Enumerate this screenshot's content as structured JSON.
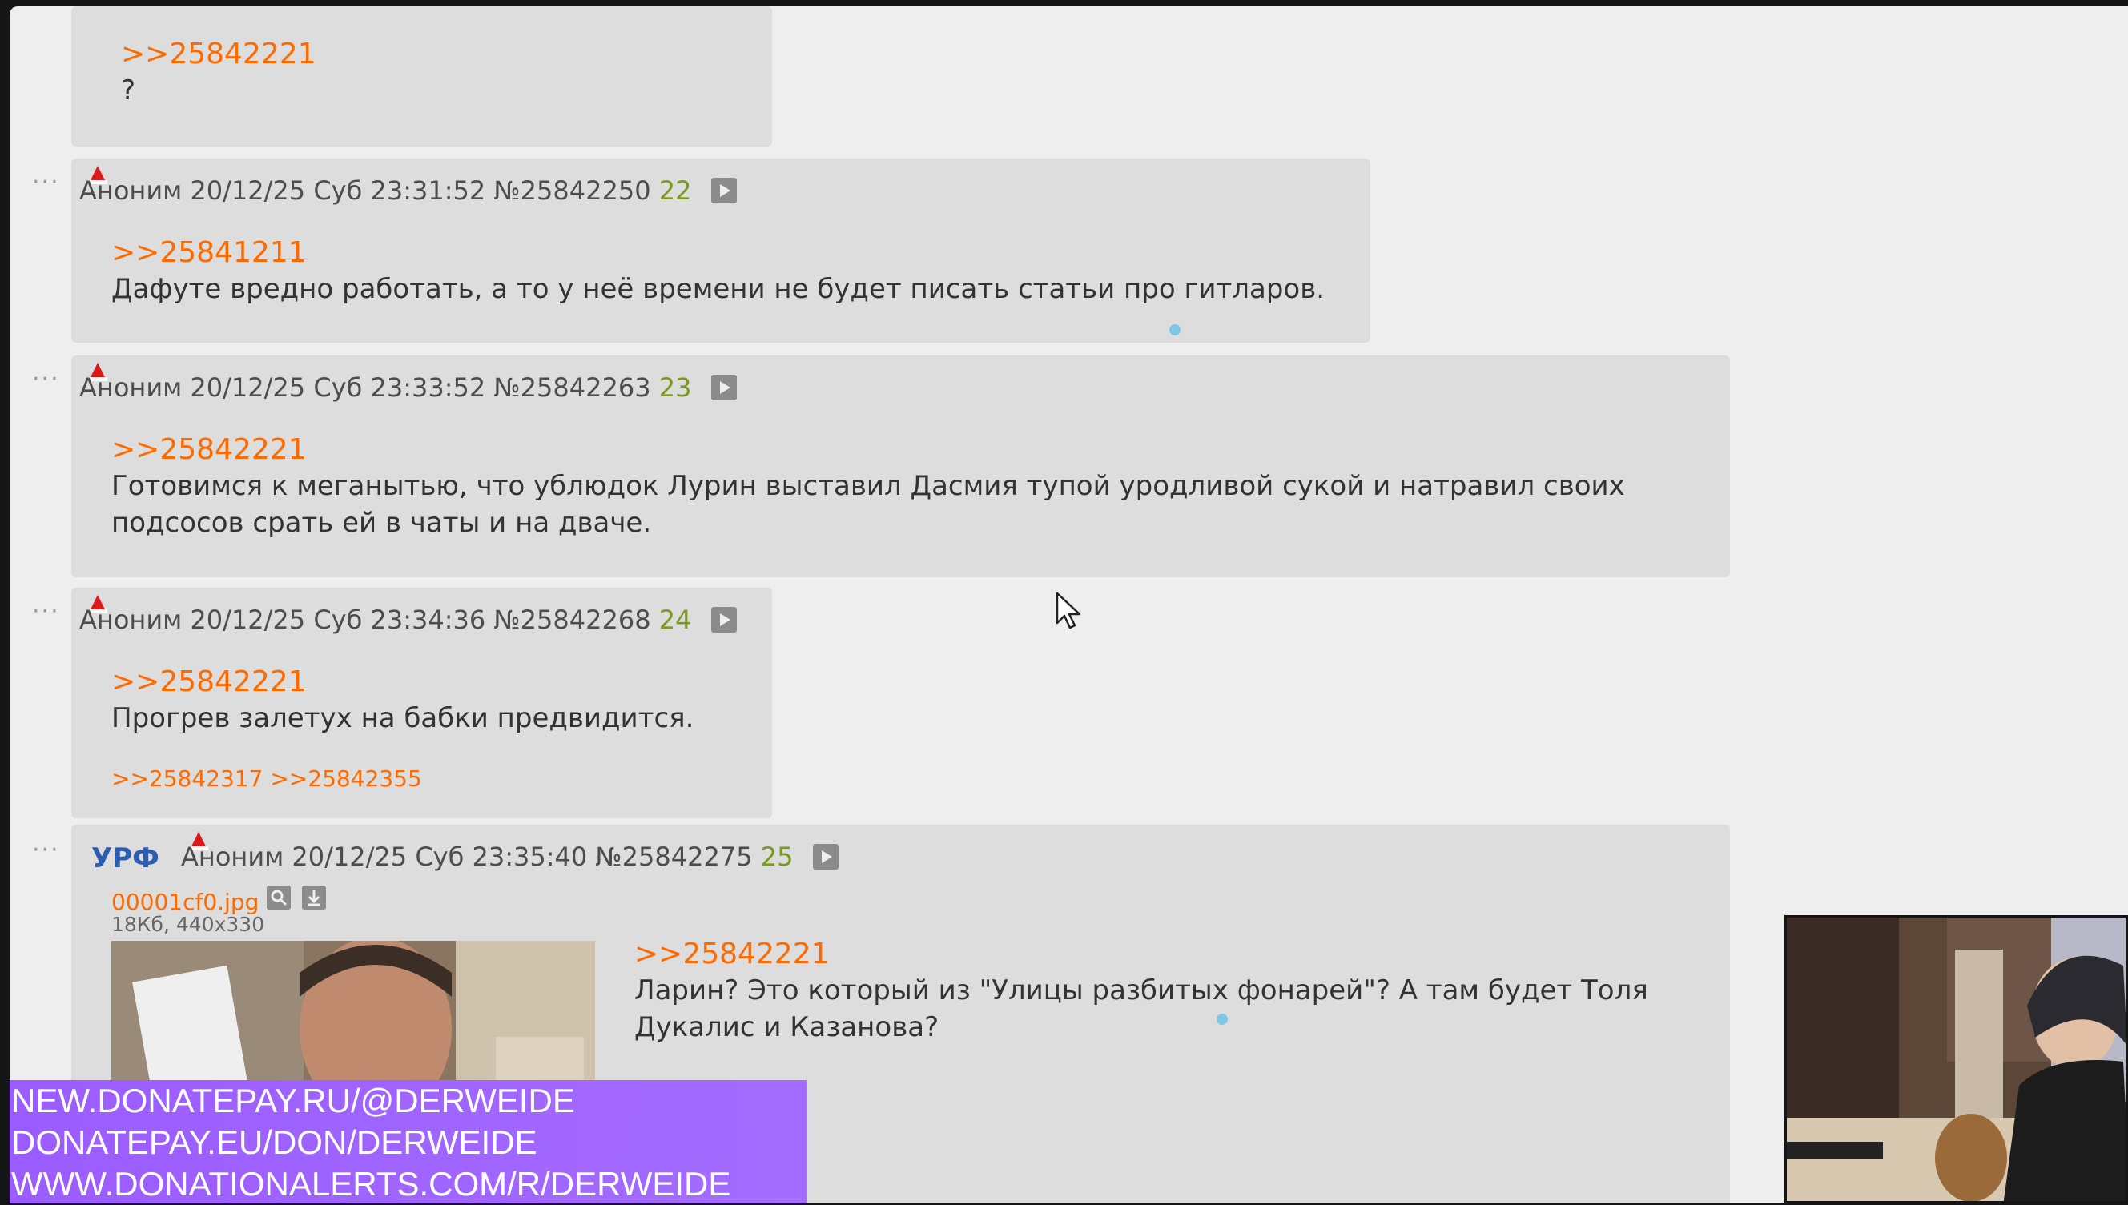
{
  "posts": [
    {
      "reply": ">>25842221",
      "text": "?"
    },
    {
      "author": "Аноним",
      "datetime": "20/12/25 Суб 23:31:52",
      "postnum": "№25842250",
      "index": "22",
      "reply": ">>25841211",
      "text": "Дафуте вредно работать, а то у неё времени не будет писать статьи про гитларов."
    },
    {
      "author": "Аноним",
      "datetime": "20/12/25 Суб 23:33:52",
      "postnum": "№25842263",
      "index": "23",
      "reply": ">>25842221",
      "text": "Готовимся к меганытью, что ублюдок Лурин выставил Дасмия тупой уродливой сукой и натравил своих подсосов срать ей в чаты и на дваче."
    },
    {
      "author": "Аноним",
      "datetime": "20/12/25 Суб 23:34:36",
      "postnum": "№25842268",
      "index": "24",
      "reply": ">>25842221",
      "text": "Прогрев залетух на бабки предвидится.",
      "backlinks": ">>25842317 >>25842355"
    },
    {
      "flag": "УРФ",
      "author": "Аноним",
      "datetime": "20/12/25 Суб 23:35:40",
      "postnum": "№25842275",
      "index": "25",
      "file_name": "00001cf0.jpg",
      "file_meta": "18Кб, 440x330",
      "reply": ">>25842221",
      "text": "Ларин? Это который из \"Улицы разбитых фонарей\"? А там будет Толя Дукалис и Казанова?"
    }
  ],
  "overlay": {
    "donate_lines": [
      "NEW.DONATEPAY.RU/@DERWEIDE",
      "DONATEPAY.EU/DON/DERWEIDE",
      "WWW.DONATIONALERTS.COM/R/DERWEIDE"
    ]
  },
  "icons": {
    "post_menu": "ellipsis-icon",
    "hat": "santa-hat-icon",
    "play": "play-icon",
    "search": "search-icon",
    "download": "download-icon"
  },
  "colors": {
    "page_bg": "#eeeeee",
    "post_bg": "#dddddd",
    "reply_link": "#ff6a00",
    "post_index": "#7a9a1f",
    "flag": "#2d5db0",
    "donate_bg": "#9b5cff"
  }
}
